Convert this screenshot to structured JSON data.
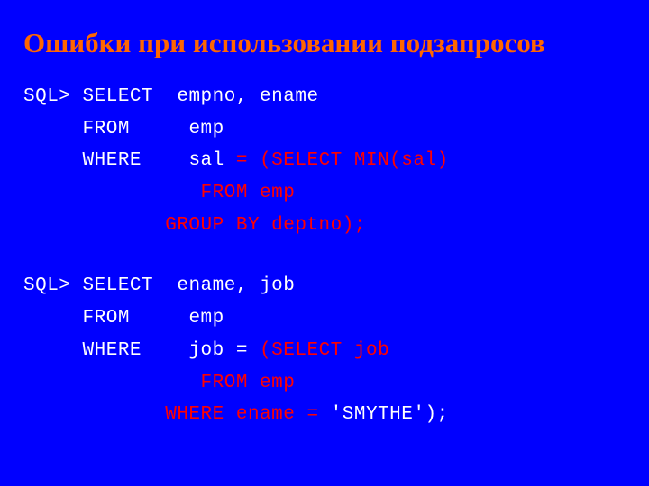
{
  "title": "Ошибки при использовании подзапросов",
  "q1": {
    "l1a": "SQL> SELECT ",
    "l1b": " empno, ename",
    "l2a": "     FROM   ",
    "l2b": "  emp",
    "l3a": "     WHERE  ",
    "l3b": "  sal ",
    "l3c": "= (SELECT MIN(sal)",
    "l4": "               FROM emp",
    "l5": "            GROUP BY deptno);"
  },
  "q2": {
    "l1a": "SQL> SELECT ",
    "l1b": " ename, job",
    "l2a": "     FROM   ",
    "l2b": "  emp",
    "l3a": "     WHERE  ",
    "l3b": "  job = ",
    "l3c": "(SELECT job",
    "l4": "               FROM emp",
    "l5a": "            WHERE ename = ",
    "l5b": "'SMYTHE');"
  }
}
